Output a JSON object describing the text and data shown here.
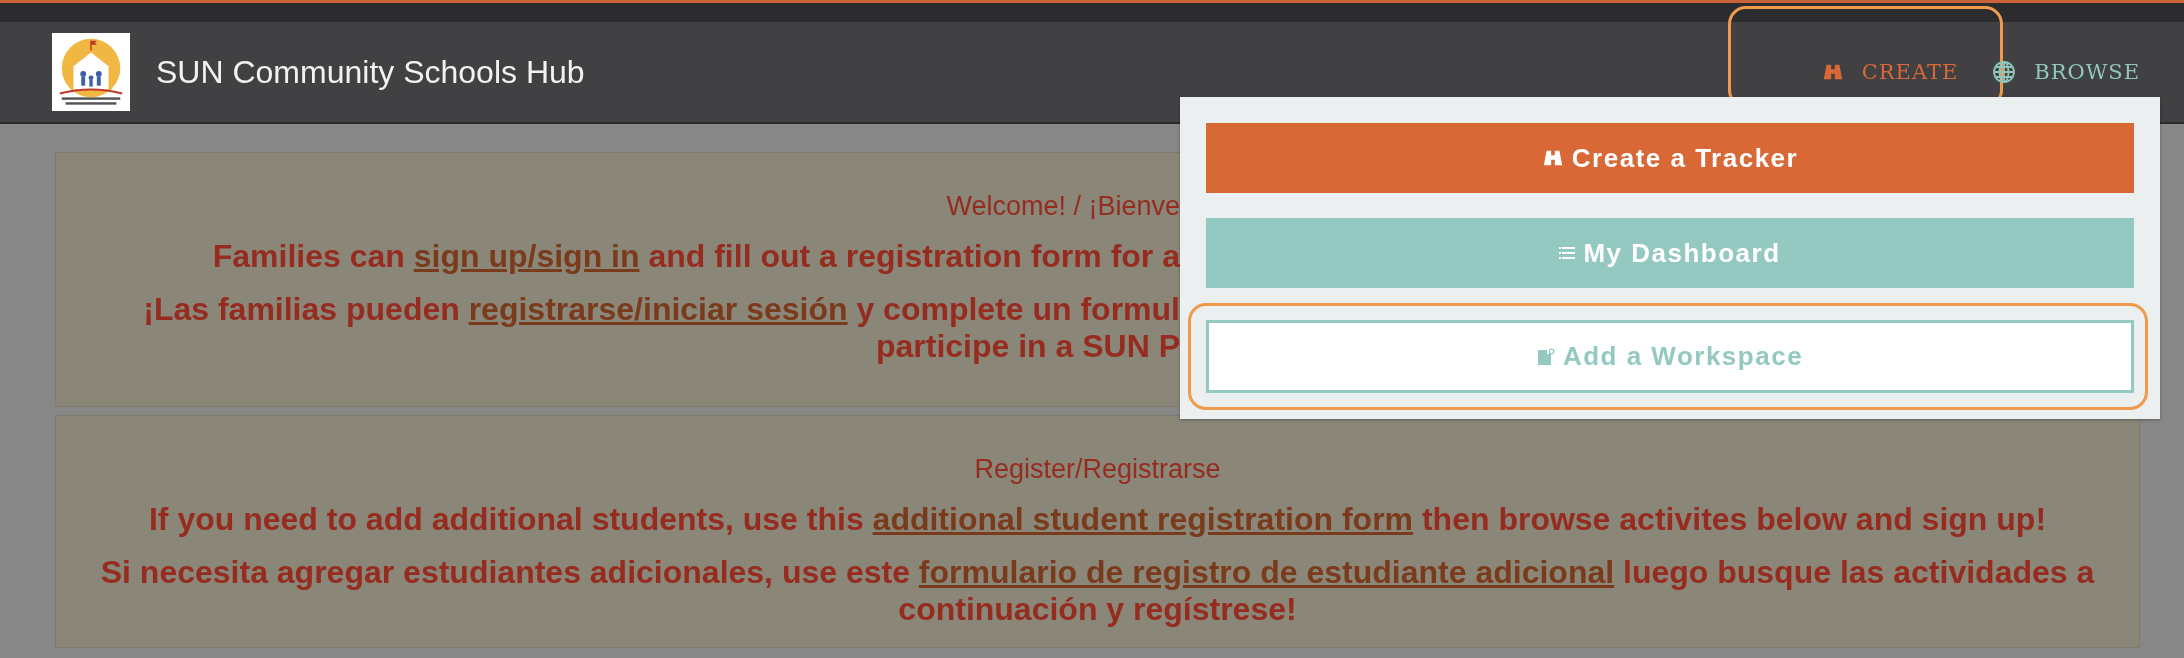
{
  "header": {
    "title": "SUN Community Schools Hub",
    "nav": [
      {
        "label": "CREATE",
        "kind": "create",
        "highlighted": true
      },
      {
        "label": "BROWSE",
        "kind": "browse",
        "highlighted": false
      }
    ]
  },
  "dropdown": {
    "items": [
      {
        "label": "Create a Tracker",
        "kind": "create",
        "highlighted": false
      },
      {
        "label": "My Dashboard",
        "kind": "dashboard",
        "highlighted": false
      },
      {
        "label": "Add a Workspace",
        "kind": "workspace",
        "highlighted": true
      }
    ]
  },
  "cards": [
    {
      "covered": true,
      "heading": "Welcome! / ¡Bienve",
      "lines": [
        [
          {
            "kind": "text",
            "text": "Families can "
          },
          {
            "kind": "link",
            "text": "sign up/sign in"
          },
          {
            "kind": "text",
            "text": " and fill out a registration form for a"
          }
        ],
        [
          {
            "kind": "text",
            "text": "¡Las familias pueden "
          },
          {
            "kind": "link",
            "text": "registrarse/iniciar sesión"
          },
          {
            "kind": "text",
            "text": " y complete un formul"
          },
          {
            "kind": "break"
          },
          {
            "kind": "text",
            "text": "participe in a SUN P"
          }
        ]
      ]
    },
    {
      "covered": false,
      "heading": "Register/Registrarse",
      "lines": [
        [
          {
            "kind": "text",
            "text": "If you need to add additional students, use this "
          },
          {
            "kind": "link",
            "text": "additional student registration form"
          },
          {
            "kind": "text",
            "text": " then browse activites below and sign up!"
          }
        ],
        [
          {
            "kind": "text",
            "text": "Si necesita agregar estudiantes adicionales, use este "
          },
          {
            "kind": "link",
            "text": "formulario de registro de estudiante adicional"
          },
          {
            "kind": "text",
            "text": " luego busque las actividades a continuación y regístrese!"
          }
        ]
      ]
    }
  ]
}
